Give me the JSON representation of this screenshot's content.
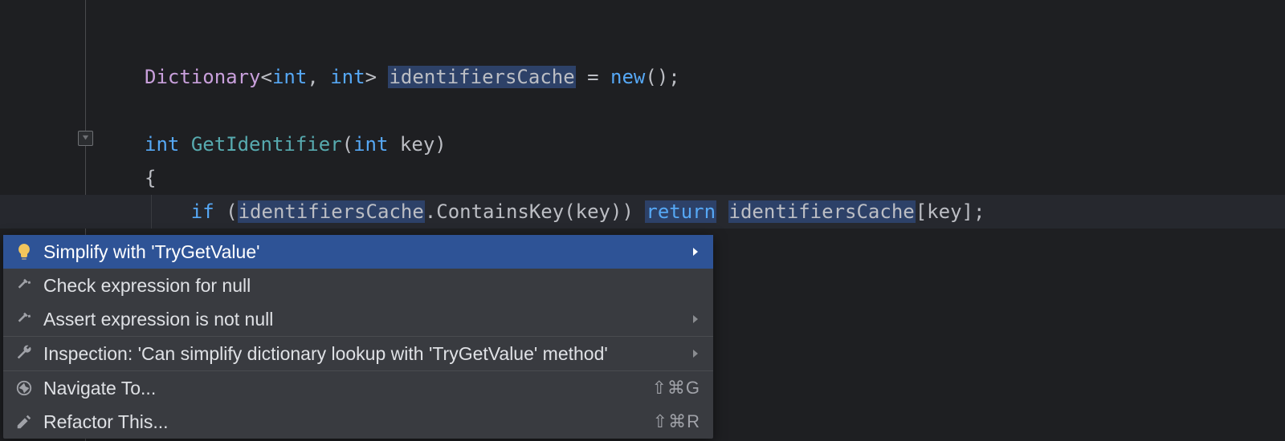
{
  "code": {
    "line1": {
      "dictionary": "Dictionary",
      "lt": "<",
      "int1": "int",
      "comma": ", ",
      "int2": "int",
      "gt": "> ",
      "ident": "identifiersCache",
      "eq": " = ",
      "new": "new",
      "parens": "();"
    },
    "line3": {
      "int": "int",
      "sp": " ",
      "method": "GetIdentifier",
      "open": "(",
      "paramtype": "int",
      "sp2": " ",
      "param": "key",
      "close": ")"
    },
    "line4": {
      "brace": "{"
    },
    "line5": {
      "indent": "    ",
      "ifkw": "if",
      "sp": " (",
      "ident1": "identifiersCache",
      "dot": ".",
      "contains": "ContainsKey",
      "open": "(",
      "key1": "key",
      "close": ")) ",
      "return": "return",
      "sp2": " ",
      "ident2": "identifiersCache",
      "bracket1": "[",
      "key2": "key",
      "bracket2": "];"
    }
  },
  "menu": {
    "items": [
      {
        "label": "Simplify with 'TryGetValue'",
        "icon": "bulb",
        "selected": true,
        "arrow": true,
        "shortcut": ""
      },
      {
        "label": "Check expression for null",
        "icon": "hammer",
        "selected": false,
        "arrow": false,
        "shortcut": ""
      },
      {
        "label": "Assert expression is not null",
        "icon": "hammer",
        "selected": false,
        "arrow": true,
        "shortcut": ""
      },
      {
        "label": "Inspection: 'Can simplify dictionary lookup with 'TryGetValue' method'",
        "icon": "wrench",
        "selected": false,
        "arrow": true,
        "shortcut": ""
      },
      {
        "label": "Navigate To...",
        "icon": "compass",
        "selected": false,
        "arrow": false,
        "shortcut": "⇧⌘G"
      },
      {
        "label": "Refactor This...",
        "icon": "pencil",
        "selected": false,
        "arrow": false,
        "shortcut": "⇧⌘R"
      }
    ]
  }
}
